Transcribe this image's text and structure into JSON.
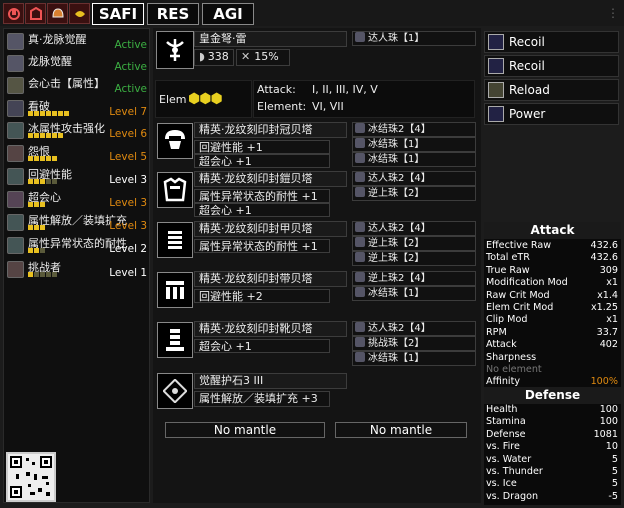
{
  "top": {
    "tabs": [
      {
        "label": "SAFI"
      },
      {
        "label": "RES"
      },
      {
        "label": "AGI"
      }
    ]
  },
  "skills": [
    {
      "name": "真·龙脉觉醒",
      "level": "Active",
      "color": "#3cb043",
      "pips_total": 0,
      "pips_on": 0
    },
    {
      "name": "龙脉觉醒",
      "level": "Active",
      "color": "#3cb043",
      "pips_total": 0,
      "pips_on": 0
    },
    {
      "name": "会心击【属性】",
      "level": "Active",
      "color": "#3cb043",
      "pips_total": 0,
      "pips_on": 0
    },
    {
      "name": "看破",
      "level": "Level 7",
      "color": "#e08a10",
      "pips_total": 7,
      "pips_on": 7
    },
    {
      "name": "冰属性攻击强化",
      "level": "Level 6",
      "color": "#e08a10",
      "pips_total": 6,
      "pips_on": 6
    },
    {
      "name": "怨恨",
      "level": "Level 5",
      "color": "#e08a10",
      "pips_total": 5,
      "pips_on": 5
    },
    {
      "name": "回避性能",
      "level": "Level 3",
      "color": "#ffffff",
      "pips_total": 5,
      "pips_on": 3
    },
    {
      "name": "超会心",
      "level": "Level 3",
      "color": "#e08a10",
      "pips_total": 3,
      "pips_on": 3
    },
    {
      "name": "属性解放／装填扩充",
      "level": "Level 3",
      "color": "#e08a10",
      "pips_total": 3,
      "pips_on": 3
    },
    {
      "name": "属性异常状态的耐性",
      "level": "Level 2",
      "color": "#ffffff",
      "pips_total": 3,
      "pips_on": 2
    },
    {
      "name": "挑战者",
      "level": "Level 1",
      "color": "#ffffff",
      "pips_total": 5,
      "pips_on": 1
    }
  ],
  "weapon": {
    "name": "皇金弩·雷",
    "defense": "338",
    "affinity": "15%",
    "deco": "达人珠【1】",
    "elem_label": "Elem",
    "attack_label": "Attack:",
    "attack_levels": "I, II, III, IV, V",
    "element_label": "Element:",
    "element_levels": "VI, VII"
  },
  "armor": [
    {
      "name": "精英·龙纹刻印封冠贝塔",
      "skills": [
        "回避性能 +1",
        "超会心 +1"
      ],
      "decos": [
        "冰结珠2【4】",
        "冰结珠【1】",
        "冰结珠【1】"
      ]
    },
    {
      "name": "精英·龙纹刻印封鎧贝塔",
      "skills": [
        "属性异常状态的耐性 +1",
        "超会心 +1"
      ],
      "decos": [
        "达人珠2【4】",
        "逆上珠【2】"
      ]
    },
    {
      "name": "精英·龙纹刻印封甲贝塔",
      "skills": [
        "属性异常状态的耐性 +1"
      ],
      "decos": [
        "达人珠2【4】",
        "逆上珠【2】",
        "逆上珠【2】"
      ]
    },
    {
      "name": "精英·龙纹刻印封带贝塔",
      "skills": [
        "回避性能 +2"
      ],
      "decos": [
        "逆上珠2【4】",
        "冰结珠【1】"
      ]
    },
    {
      "name": "精英·龙纹刻印封靴贝塔",
      "skills": [
        "超会心 +1"
      ],
      "decos": [
        "达人珠2【4】",
        "挑战珠【2】",
        "冰结珠【1】"
      ]
    }
  ],
  "charm": {
    "name": "觉醒护石3 III",
    "skill": "属性解放／装填扩充 +3"
  },
  "mantles": [
    "No mantle",
    "No mantle"
  ],
  "ammo": [
    {
      "label": "Recoil"
    },
    {
      "label": "Recoil"
    },
    {
      "label": "Reload"
    },
    {
      "label": "Power"
    }
  ],
  "attack": {
    "title": "Attack",
    "rows": [
      {
        "label": "Effective Raw",
        "value": "432.6"
      },
      {
        "label": "Total eTR",
        "value": "432.6"
      },
      {
        "label": "True Raw",
        "value": "309"
      },
      {
        "label": "Modification Mod",
        "value": "x1"
      },
      {
        "label": "Raw Crit Mod",
        "value": "x1.4"
      },
      {
        "label": "Elem Crit Mod",
        "value": "x1.25"
      },
      {
        "label": "Clip Mod",
        "value": "x1"
      },
      {
        "label": "RPM",
        "value": "33.7"
      },
      {
        "label": "Attack",
        "value": "402"
      },
      {
        "label": "Sharpness",
        "value": ""
      },
      {
        "label": "No element",
        "value": ""
      },
      {
        "label": "Affinity",
        "value": "100%"
      }
    ]
  },
  "defense": {
    "title": "Defense",
    "rows": [
      {
        "label": "Health",
        "value": "100"
      },
      {
        "label": "Stamina",
        "value": "100"
      },
      {
        "label": "Defense",
        "value": "1081"
      },
      {
        "label": "vs. Fire",
        "value": "10"
      },
      {
        "label": "vs. Water",
        "value": "5"
      },
      {
        "label": "vs. Thunder",
        "value": "5"
      },
      {
        "label": "vs. Ice",
        "value": "5"
      },
      {
        "label": "vs. Dragon",
        "value": "-5"
      }
    ]
  }
}
